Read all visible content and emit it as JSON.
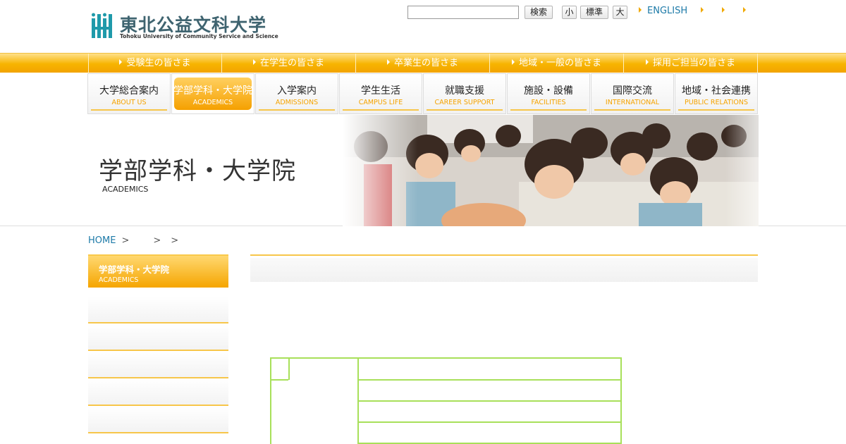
{
  "header": {
    "logo_ja": "東北公益文科大学",
    "logo_en": "Tohoku University of Community Service and Science",
    "search_placeholder": "",
    "search_button": "検索",
    "font_size": {
      "small": "小",
      "normal": "標準",
      "large": "大"
    },
    "top_links": [
      {
        "label": "ENGLISH"
      },
      {
        "label": ""
      },
      {
        "label": ""
      }
    ]
  },
  "audience_nav": [
    {
      "label": "受験生の皆さま"
    },
    {
      "label": "在学生の皆さま"
    },
    {
      "label": "卒業生の皆さま"
    },
    {
      "label": "地域・一般の皆さま"
    },
    {
      "label": "採用ご担当の皆さま"
    }
  ],
  "main_nav": [
    {
      "ja": "大学総合案内",
      "en": "ABOUT US"
    },
    {
      "ja": "学部学科・大学院",
      "en": "ACADEMICS",
      "active": true
    },
    {
      "ja": "入学案内",
      "en": "ADMISSIONS"
    },
    {
      "ja": "学生生活",
      "en": "CAMPUS LIFE"
    },
    {
      "ja": "就職支援",
      "en": "CAREER SUPPORT"
    },
    {
      "ja": "施設・設備",
      "en": "FACILITIES"
    },
    {
      "ja": "国際交流",
      "en": "INTERNATIONAL"
    },
    {
      "ja": "地域・社会連携",
      "en": "PUBLIC RELATIONS"
    }
  ],
  "banner": {
    "title": "学部学科・大学院",
    "subtitle": "ACADEMICS"
  },
  "breadcrumb": {
    "home": "HOME",
    "sep": ">"
  },
  "sidebar": {
    "title_ja": "学部学科・大学院",
    "title_en": "ACADEMICS"
  },
  "colors": {
    "accent": "#f5a300",
    "link": "#1d7aa8",
    "table_border": "#a8e05a"
  }
}
